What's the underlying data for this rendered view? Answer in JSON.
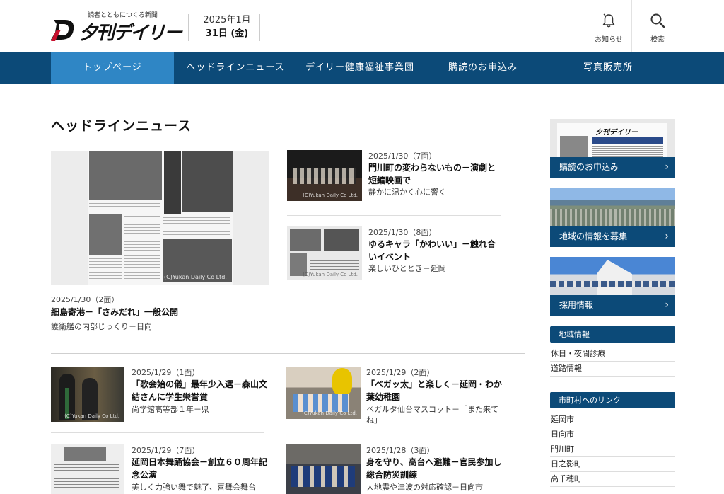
{
  "header": {
    "tagline": "読者とともにつくる新聞",
    "logo_text": "夕刊デイリー",
    "date_line1": "2025年1月",
    "date_line2": "31日 (金)",
    "notice_label": "お知らせ",
    "search_label": "検索"
  },
  "nav": {
    "items": [
      {
        "label": "トップページ"
      },
      {
        "label": "ヘッドラインニュース"
      },
      {
        "label": "デイリー健康福祉事業団"
      },
      {
        "label": "購読のお申込み"
      },
      {
        "label": "写真販売所"
      }
    ]
  },
  "main": {
    "section_title": "ヘッドラインニュース",
    "featured": {
      "date": "2025/1/30（2面）",
      "title": "細島寄港－「さみだれ」一般公開",
      "subtitle": "護衛艦の内部じっくり－日向",
      "watermark": "(C)Yukan Daily Co Ltd."
    },
    "side_items": [
      {
        "date": "2025/1/30（7面）",
        "title": "門川町の変わらないもの－演劇と短編映画で",
        "subtitle": "静かに温かく心に響く",
        "watermark": "(C)Yukan Daily Co Ltd."
      },
      {
        "date": "2025/1/30（8面）",
        "title": "ゆるキャラ「かわいい」－触れ合いイベント",
        "subtitle": "楽しいひととき－延岡",
        "watermark": "(C)Yukan Daily Co Ltd."
      }
    ],
    "grid_items": [
      {
        "date": "2025/1/29（1面）",
        "title": "「歌会始の儀」最年少入選－森山文結さんに学生栄誉賞",
        "subtitle": "尚学館高等部１年－県",
        "watermark": "(C)Yukan Daily Co Ltd."
      },
      {
        "date": "2025/1/29（2面）",
        "title": "「ベガッ太」と楽しく－延岡・わか葉幼稚園",
        "subtitle": "ベガルタ仙台マスコット－「また来てね」",
        "watermark": "(C)Yukan Daily Co Ltd."
      },
      {
        "date": "2025/1/29（7面）",
        "title": "延岡日本舞踊協会－創立６０周年記念公演",
        "subtitle": "美しく力強い舞で魅了、喜舞会舞台",
        "watermark": ""
      },
      {
        "date": "2025/1/28（3面）",
        "title": "身を守り、高台へ避難－官民参加し総合防災訓練",
        "subtitle": "大地震や津波の対応確認－日向市",
        "watermark": ""
      }
    ]
  },
  "sidebar": {
    "banners": [
      {
        "label": "購読のお申込み",
        "chevron": "›",
        "paper_logo": "夕刊デイリー"
      },
      {
        "label": "地域の情報を募集",
        "chevron": "›"
      },
      {
        "label": "採用情報",
        "chevron": "›"
      }
    ],
    "region_head": "地域情報",
    "region_links": [
      "休日・夜間診療",
      "道路情報"
    ],
    "city_head": "市町村へのリンク",
    "city_links": [
      "延岡市",
      "日向市",
      "門川町",
      "日之影町",
      "高千穂町"
    ]
  }
}
